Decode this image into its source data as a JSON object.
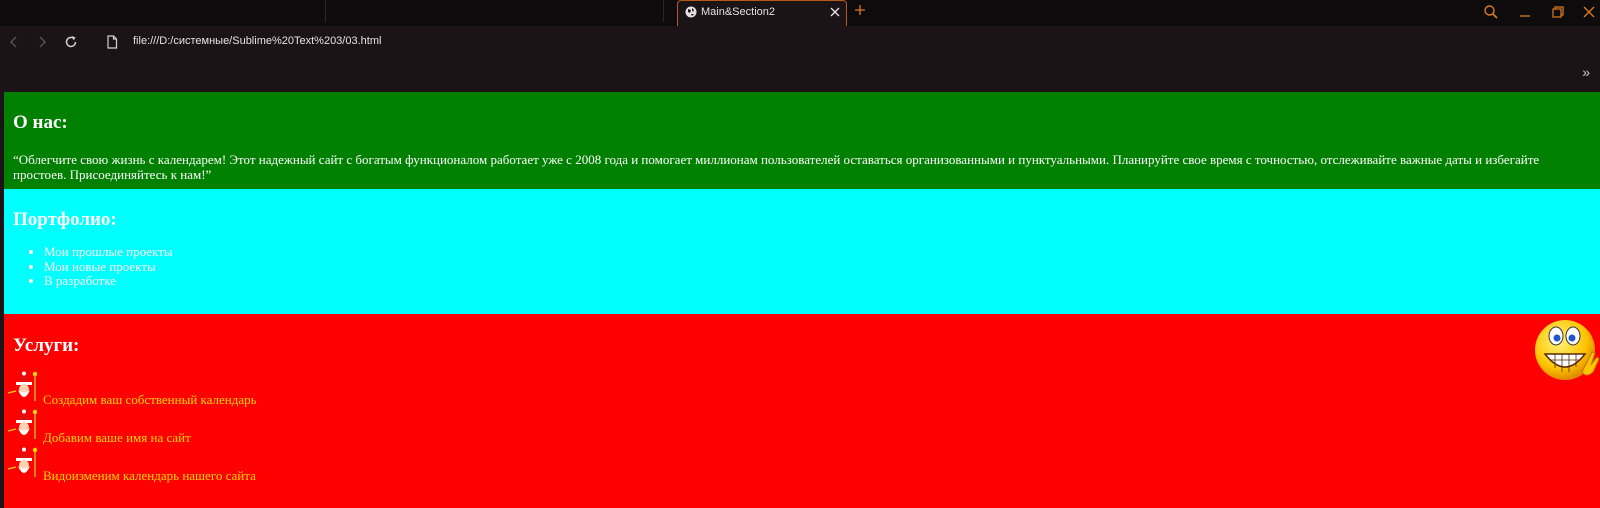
{
  "browser": {
    "tab_title": "Main&Section2",
    "url": "file:///D:/системные/Sublime%20Text%203/03.html",
    "icons": [
      "globe-icon",
      "close-icon",
      "plus-icon",
      "search-icon",
      "minimize-icon",
      "restore-icon",
      "back-icon",
      "forward-icon",
      "reload-icon",
      "page-icon",
      "chevron-right-icon"
    ],
    "accent_color": "#e07a1f",
    "bookmarks_overflow": "»"
  },
  "page": {
    "about": {
      "title": "О нас:",
      "text": "“Облегчите свою жизнь с календарем! Этот надежный сайт с богатым функционалом работает уже с 2008 года и помогает миллионам пользователей оставаться организованными и пунктуальными. Планируйте свое время с точностью, отслеживайте важные даты и избегайте простоев. Присоединяйтесь к нам!”",
      "background": "#008000"
    },
    "portfolio": {
      "title": "Портфолио:",
      "items": [
        "Мои прошлые проекты",
        "Мои новые проекты",
        "В разработке"
      ],
      "background": "#00ffff"
    },
    "services": {
      "title": "Услуги:",
      "items": [
        "Создадим ваш собственный календарь",
        "Добавим ваше имя на сайт",
        "Видоизменим календарь нашего сайта"
      ],
      "item_icon": "santa-icon",
      "decor_icon": "smiley-icon",
      "background": "#ff0000",
      "text_color": "#ffd700"
    }
  }
}
